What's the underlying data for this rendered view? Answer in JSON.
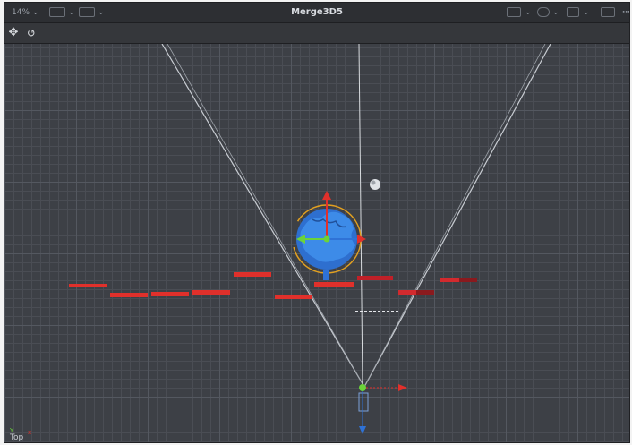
{
  "window": {
    "title": "Merge3D5",
    "zoom_label": "14%",
    "colors": {
      "accent_red": "#e0302b",
      "accent_green": "#6bd33a",
      "accent_blue": "#2f72d6",
      "gizmo_orange": "#e2a020"
    }
  },
  "toolbar": {
    "left_icons": [
      "view-layout-icon",
      "render-icon"
    ],
    "right_icons": [
      "display-icon",
      "sphere-icon",
      "grid-icon",
      "fullscreen-icon",
      "more-icon"
    ],
    "tools": [
      "move-tool-icon",
      "reset-rotate-icon"
    ]
  },
  "viewport": {
    "view_name": "Top",
    "axis_y": "Y",
    "axis_x": "x"
  }
}
